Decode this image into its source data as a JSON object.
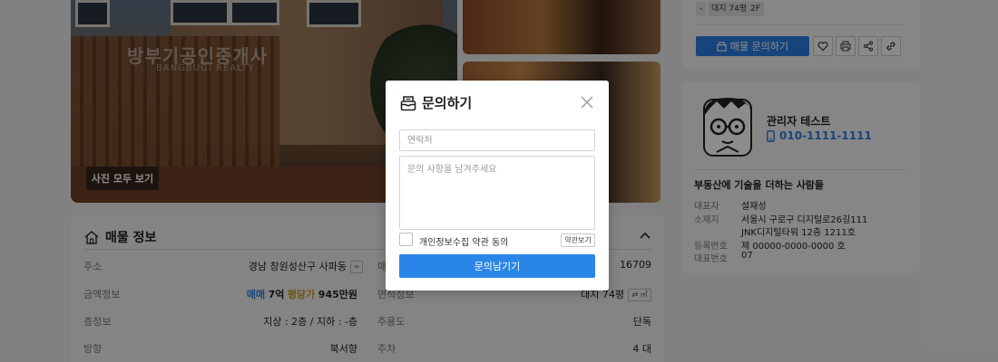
{
  "gallery": {
    "watermark": "방부기공인중개사",
    "watermark_sub": "BANGBUGI REALTY",
    "view_all_label": "사진 모두 보기"
  },
  "property_info": {
    "title": "매물 정보",
    "rows_left": [
      {
        "label": "주소",
        "value": "경남 창원성산구 사파동"
      },
      {
        "label": "금액정보",
        "value_parts": [
          "매매",
          "7억",
          "평당가",
          "945만원"
        ]
      },
      {
        "label": "층정보",
        "value": "지상 : 2층 / 지하 : -층"
      },
      {
        "label": "방향",
        "value": "북서향"
      }
    ],
    "rows_right": [
      {
        "label": "매",
        "value": "16709"
      },
      {
        "label": "면적정보",
        "value": "대지 74평"
      },
      {
        "label": "주용도",
        "value": "단독"
      },
      {
        "label": "주차",
        "value": "4 대"
      }
    ],
    "area_unit_toggle": "㎡"
  },
  "summary": {
    "tags": [
      "-",
      "대지 74평",
      "2F"
    ],
    "inquiry_button": "매물 문의하기"
  },
  "agent": {
    "name": "관리자 테스트",
    "phone": "010-1111-1111",
    "slogan": "부동산에 기술을 더하는 사람들",
    "rows": [
      {
        "label": "대표자",
        "value": "설재성"
      },
      {
        "label": "소재지",
        "value": "서울시 구로구 디지털로26길111"
      },
      {
        "label": "",
        "value": "JNK디지털타워 12층 1211호"
      },
      {
        "label": "등록번호",
        "value": "제 00000-0000-0000 호"
      },
      {
        "label": "대표번호",
        "value": "07"
      }
    ]
  },
  "modal": {
    "title": "문의하기",
    "contact_placeholder": "연락처",
    "message_placeholder": "문의 사항을 남겨주세요",
    "agree_label": "개인정보수집 약관 동의",
    "terms_button": "약관보기",
    "submit_button": "문의남기기"
  },
  "colors": {
    "accent": "#2a86e6",
    "price_type": "#2a7de1",
    "price_per_pyeong": "#c79a1d"
  }
}
